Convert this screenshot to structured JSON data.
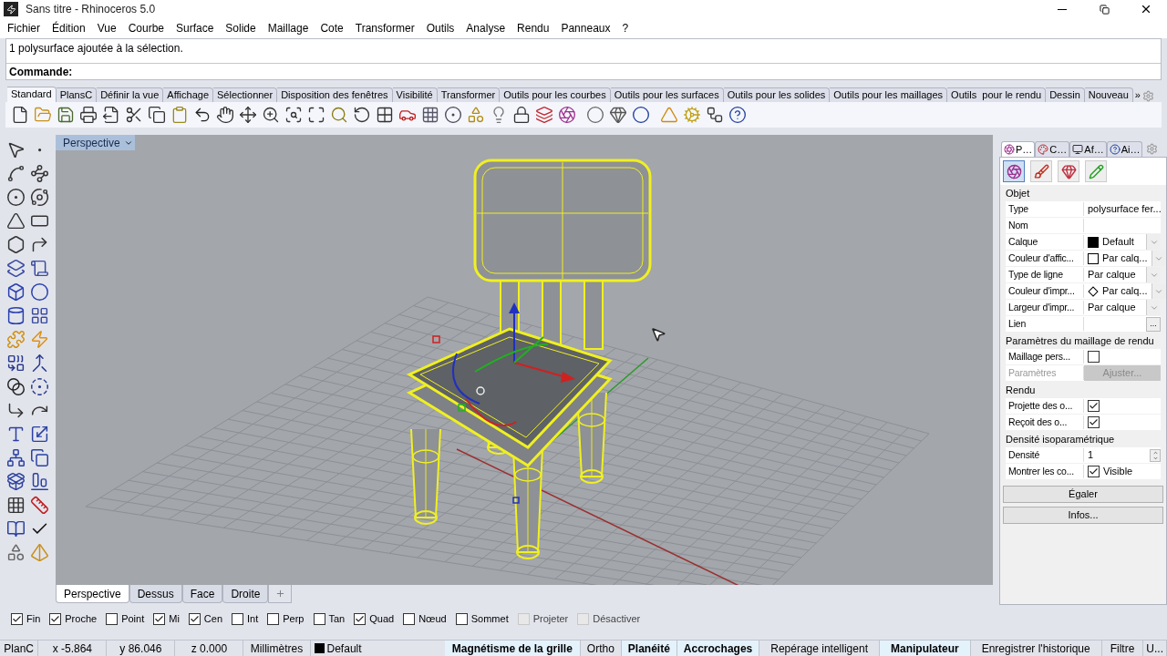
{
  "window": {
    "title": "Sans titre - Rhinoceros 5.0"
  },
  "menu": [
    "Fichier",
    "Édition",
    "Vue",
    "Courbe",
    "Surface",
    "Solide",
    "Maillage",
    "Cote",
    "Transformer",
    "Outils",
    "Analyse",
    "Rendu",
    "Panneaux",
    "?"
  ],
  "command": {
    "history": "1 polysurface ajoutée à la sélection.",
    "prompt": "Commande:"
  },
  "toolbar_tabs": [
    {
      "label": "Standard",
      "selected": true
    },
    {
      "label": "PlansC",
      "selected": false
    },
    {
      "label": "Définir la vue",
      "selected": false
    },
    {
      "label": "Affichage",
      "selected": false
    },
    {
      "label": "Sélectionner",
      "selected": false
    },
    {
      "label": "Disposition des fenêtres",
      "selected": false
    },
    {
      "label": "Visibilité",
      "selected": false
    },
    {
      "label": "Transformer",
      "selected": false
    },
    {
      "label": "Outils pour les courbes",
      "selected": false
    },
    {
      "label": "Outils pour les surfaces",
      "selected": false
    },
    {
      "label": "Outils pour les solides",
      "selected": false
    },
    {
      "label": "Outils pour les maillages",
      "selected": false
    },
    {
      "label": "Outils  pour le rendu",
      "selected": false
    },
    {
      "label": "Dessin",
      "selected": false
    },
    {
      "label": "Nouveau",
      "selected": false
    }
  ],
  "toolbar_more": "»",
  "viewport": {
    "title": "Perspective"
  },
  "viewport_tabs": [
    {
      "label": "Perspective",
      "selected": true
    },
    {
      "label": "Dessus",
      "selected": false
    },
    {
      "label": "Face",
      "selected": false
    },
    {
      "label": "Droite",
      "selected": false
    }
  ],
  "panel": {
    "tabs": [
      {
        "label": "P…",
        "selected": true
      },
      {
        "label": "C…",
        "selected": false
      },
      {
        "label": "Af…",
        "selected": false
      },
      {
        "label": "Ai…",
        "selected": false
      }
    ],
    "sections": [
      {
        "title": "Objet",
        "rows": [
          {
            "kind": "text",
            "label": "Type",
            "value": "polysurface fer..."
          },
          {
            "kind": "text",
            "label": "Nom"
          },
          {
            "kind": "swatch",
            "label": "Calque",
            "value": "Default",
            "color": "#000000"
          },
          {
            "kind": "swatch",
            "label": "Couleur d'affic...",
            "value": "Par calq...",
            "color": "#ffffff"
          },
          {
            "kind": "dropdown",
            "label": "Type de ligne",
            "value": "Par calque"
          },
          {
            "kind": "diamond",
            "label": "Couleur d'impr...",
            "value": "Par calq..."
          },
          {
            "kind": "dropdown",
            "label": "Largeur d'impr...",
            "value": "Par calque"
          },
          {
            "kind": "link",
            "label": "Lien",
            "button": "..."
          }
        ]
      },
      {
        "title": "Paramètres du maillage de rendu",
        "rows": [
          {
            "kind": "checkbox",
            "label": "Maillage pers...",
            "checked": false
          },
          {
            "kind": "button",
            "label": "Paramètres",
            "button": "Ajuster...",
            "disabled": true
          }
        ]
      },
      {
        "title": "Rendu",
        "rows": [
          {
            "kind": "checkbox",
            "label": "Projette des o...",
            "checked": true
          },
          {
            "kind": "checkbox",
            "label": "Reçoit des o...",
            "checked": true
          }
        ]
      },
      {
        "title": "Densité isoparamétrique",
        "rows": [
          {
            "kind": "spinner",
            "label": "Densité",
            "value": "1"
          },
          {
            "kind": "checkbox",
            "label": "Montrer les co...",
            "checked": true,
            "value": "Visible"
          }
        ]
      }
    ],
    "buttons": [
      "Égaler",
      "Infos..."
    ]
  },
  "osnaps": [
    {
      "label": "Fin",
      "checked": true,
      "disabled": false
    },
    {
      "label": "Proche",
      "checked": true,
      "disabled": false
    },
    {
      "label": "Point",
      "checked": false,
      "disabled": false
    },
    {
      "label": "Mi",
      "checked": true,
      "disabled": false
    },
    {
      "label": "Cen",
      "checked": true,
      "disabled": false
    },
    {
      "label": "Int",
      "checked": false,
      "disabled": false
    },
    {
      "label": "Perp",
      "checked": false,
      "disabled": false
    },
    {
      "label": "Tan",
      "checked": false,
      "disabled": false
    },
    {
      "label": "Quad",
      "checked": true,
      "disabled": false
    },
    {
      "label": "Nœud",
      "checked": false,
      "disabled": false
    },
    {
      "label": "Sommet",
      "checked": false,
      "disabled": false
    },
    {
      "label": "Projeter",
      "checked": false,
      "disabled": true
    },
    {
      "label": "Désactiver",
      "checked": false,
      "disabled": true
    }
  ],
  "status_bar": {
    "fields": [
      "PlanC",
      "x -5.864",
      "y 86.046",
      "z 0.000",
      "Millimètres"
    ],
    "layer": "Default",
    "toggles": [
      {
        "label": "Magnétisme de la grille",
        "on": true
      },
      {
        "label": "Ortho",
        "on": false
      },
      {
        "label": "Planéité",
        "on": true
      },
      {
        "label": "Accrochages",
        "on": true
      },
      {
        "label": "Repérage intelligent",
        "on": false
      },
      {
        "label": "Manipulateur",
        "on": true
      },
      {
        "label": "Enregistrer l'historique",
        "on": false
      },
      {
        "label": "Filtre",
        "on": false
      },
      {
        "label": "U...",
        "on": false
      }
    ]
  }
}
